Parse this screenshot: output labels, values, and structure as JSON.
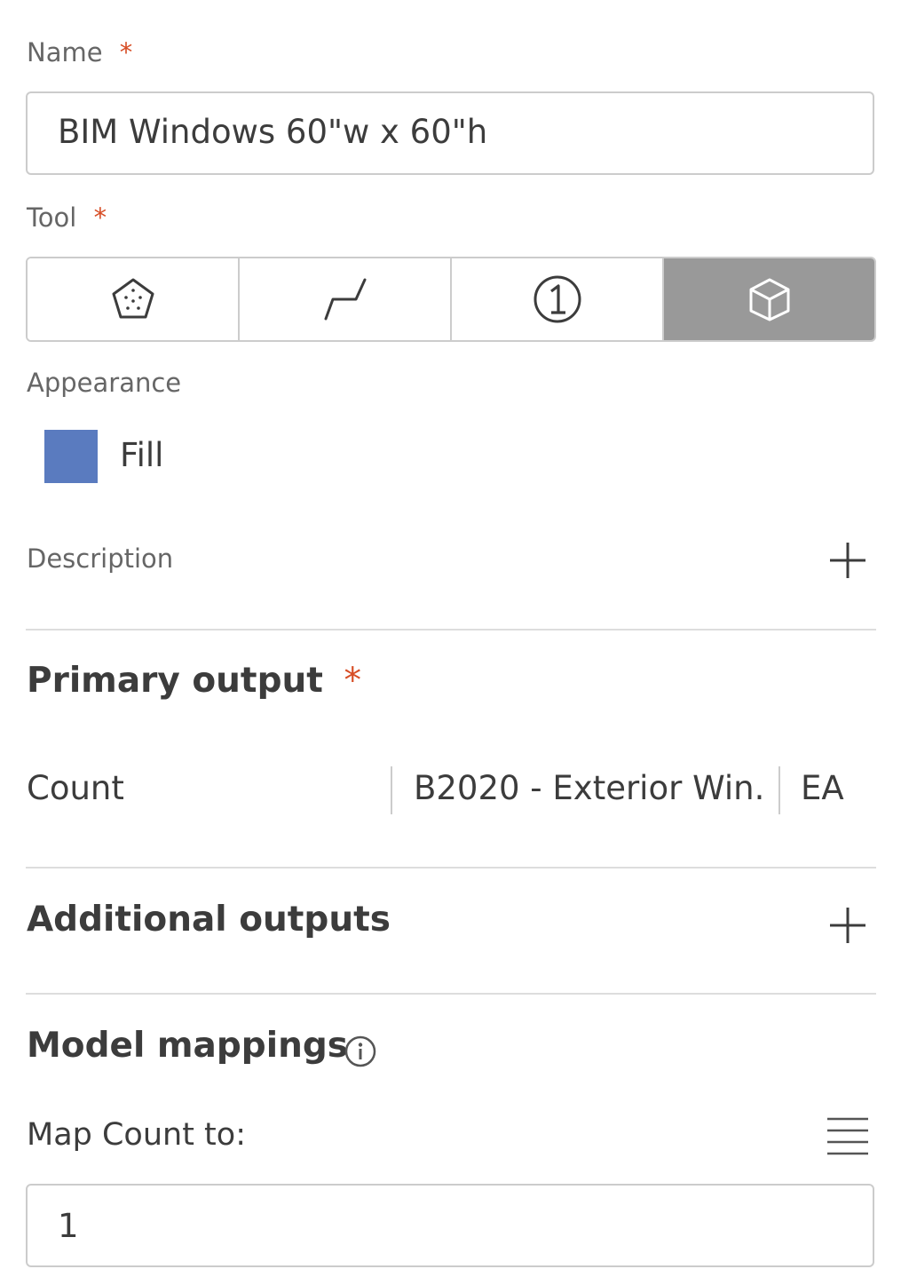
{
  "name_field": {
    "label": "Name",
    "required_mark": "*",
    "value": "BIM Windows 60\"w x 60\"h"
  },
  "tool_field": {
    "label": "Tool",
    "required_mark": "*",
    "options": [
      {
        "icon": "pentagon-area-icon",
        "active": false
      },
      {
        "icon": "polyline-linear-icon",
        "active": false
      },
      {
        "icon": "count-circle-icon",
        "active": false
      },
      {
        "icon": "cube-3d-icon",
        "active": true
      }
    ]
  },
  "appearance": {
    "label": "Appearance",
    "fill_label": "Fill",
    "fill_color": "#5a7bbf"
  },
  "description": {
    "label": "Description"
  },
  "primary_output": {
    "title": "Primary output",
    "required_mark": "*",
    "row": {
      "measure": "Count",
      "classification": "B2020 - Exterior Win...",
      "unit": "EA"
    }
  },
  "additional_outputs": {
    "title": "Additional outputs"
  },
  "model_mappings": {
    "title": "Model mappings",
    "map_label": "Map Count to:",
    "value": "1"
  }
}
